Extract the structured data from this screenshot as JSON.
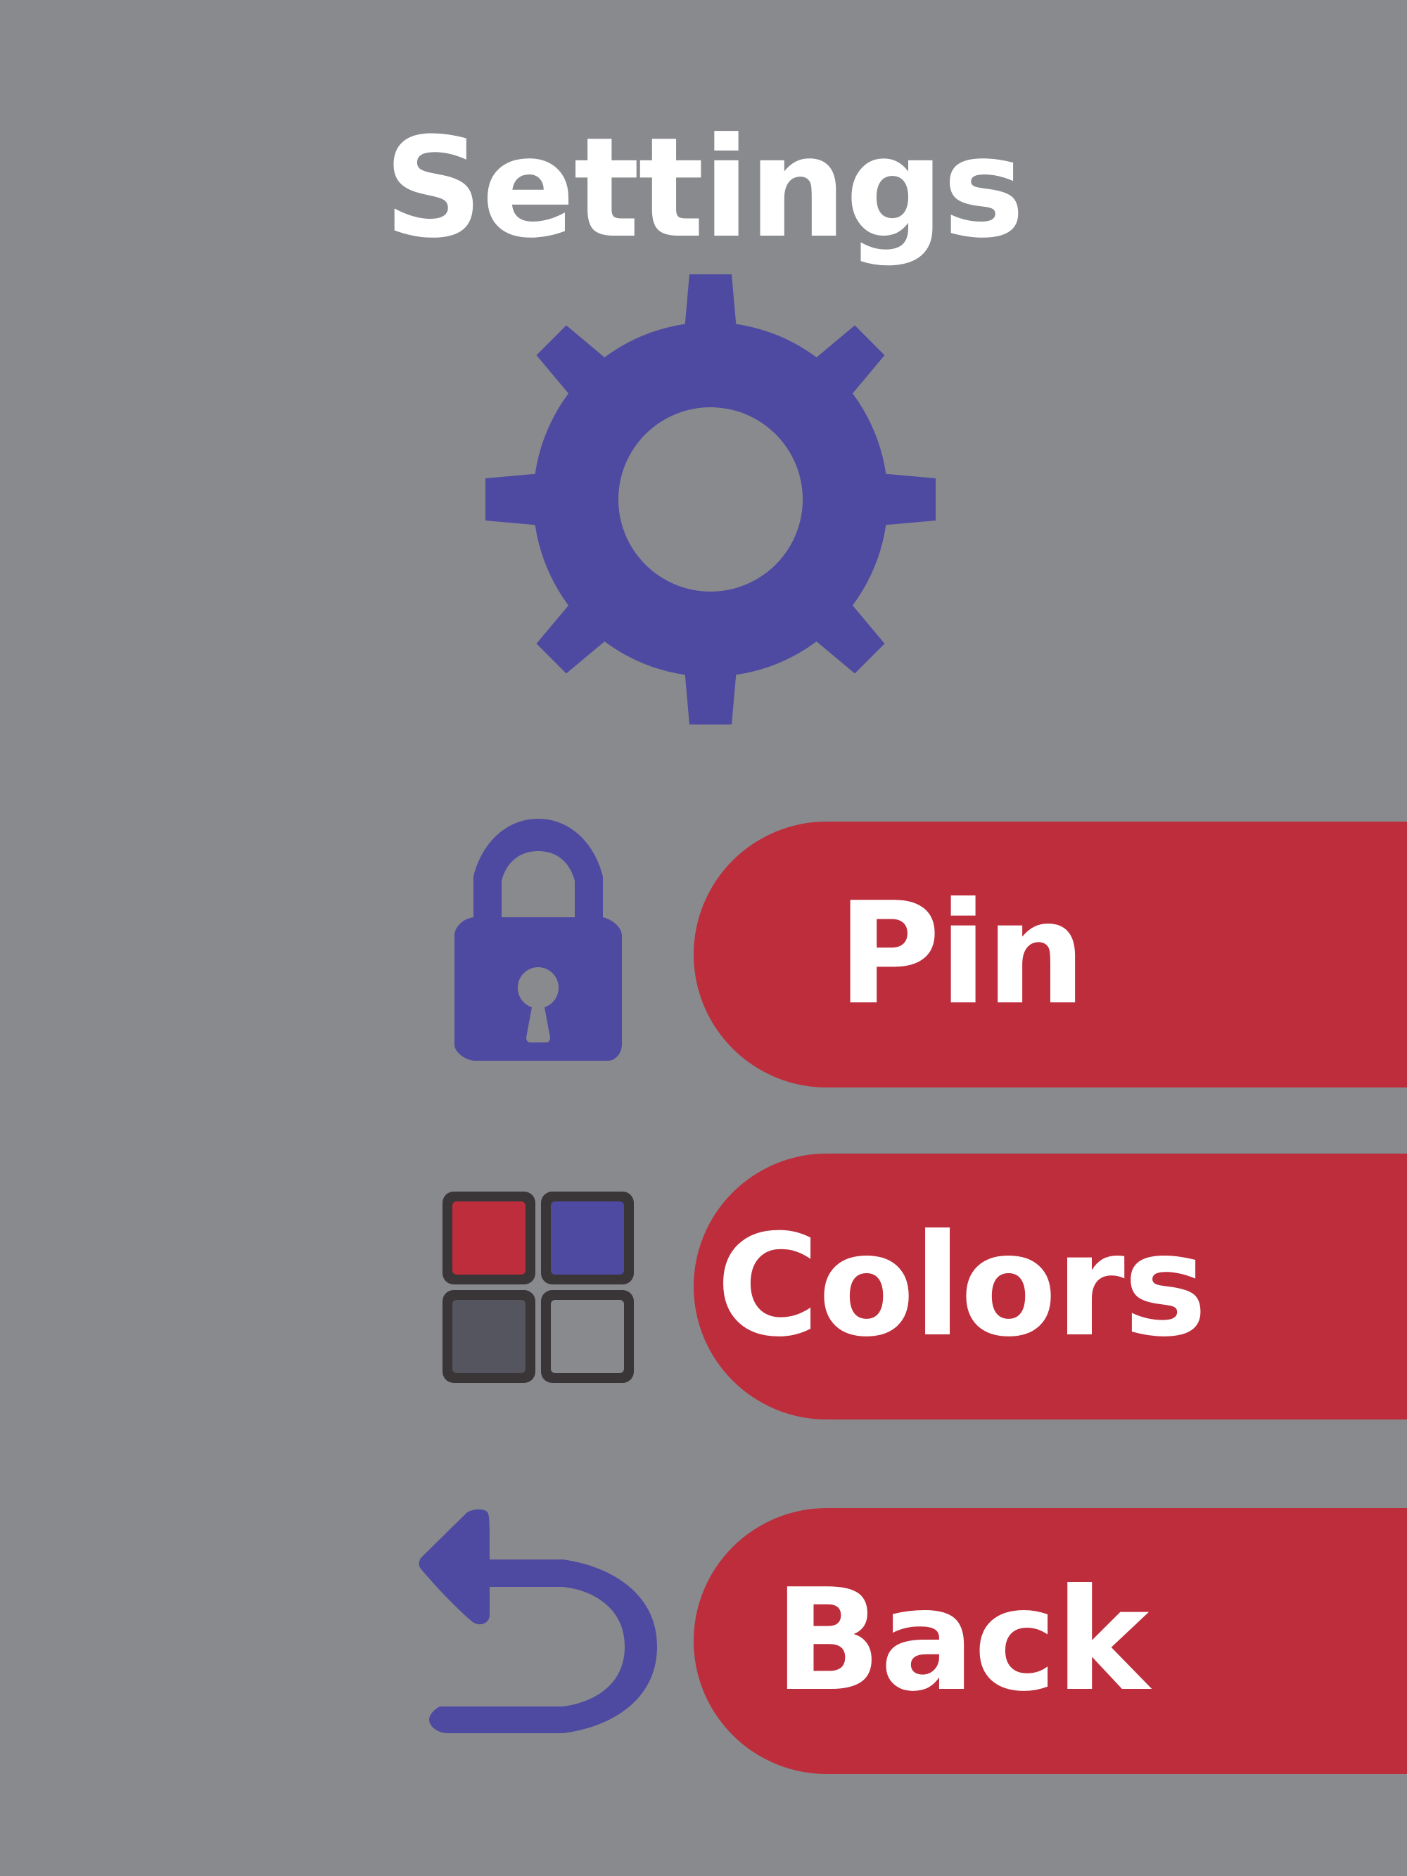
{
  "screen": {
    "title": "Settings",
    "background_color": "#898a8e"
  },
  "theme": {
    "accent_color": "#4f4aa1",
    "button_color": "#bd2d3c",
    "text_color": "#ffffff"
  },
  "header_icon": "gear-icon",
  "menu": [
    {
      "id": "pin",
      "label": "Pin",
      "icon": "lock-icon"
    },
    {
      "id": "colors",
      "label": "Colors",
      "icon": "color-palette-icon",
      "swatches": [
        "#bd2d3c",
        "#4f4aa1",
        "#55555f",
        "#898a8e"
      ]
    },
    {
      "id": "back",
      "label": "Back",
      "icon": "back-arrow-icon"
    }
  ]
}
